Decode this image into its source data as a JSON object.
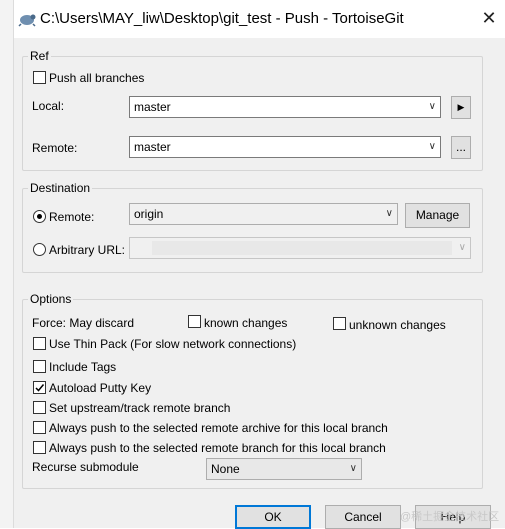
{
  "window": {
    "title": "C:\\Users\\MAY_liw\\Desktop\\git_test - Push - TortoiseGit",
    "close_symbol": "✕"
  },
  "ref": {
    "legend": "Ref",
    "push_all_label": "Push all branches",
    "push_all_checked": false,
    "local_label": "Local:",
    "local_value": "master",
    "remote_label": "Remote:",
    "remote_value": "master",
    "next_button": "▶",
    "browse_button": "..."
  },
  "destination": {
    "legend": "Destination",
    "remote_label": "Remote:",
    "remote_selected": true,
    "remote_value": "origin",
    "manage_button": "Manage",
    "arbitrary_label": "Arbitrary URL:",
    "arbitrary_selected": false,
    "arbitrary_value": ""
  },
  "options": {
    "legend": "Options",
    "force_label": "Force: May discard",
    "known_changes": "known changes",
    "unknown_changes": "unknown changes",
    "thin_pack": "Use Thin Pack (For slow network connections)",
    "include_tags": "Include Tags",
    "autoload_putty": "Autoload Putty Key",
    "autoload_putty_checked": true,
    "set_upstream": "Set upstream/track remote branch",
    "always_archive": "Always push to the selected remote archive for this local branch",
    "always_branch": "Always push to the selected remote branch for this local branch",
    "recurse_label": "Recurse submodule",
    "recurse_value": "None"
  },
  "buttons": {
    "ok": "OK",
    "cancel": "Cancel",
    "help": "Help"
  },
  "watermark": "@稀土掘金技术社区",
  "colors": {
    "accent": "#0078d7",
    "dialog_bg": "#f0f0f0"
  }
}
